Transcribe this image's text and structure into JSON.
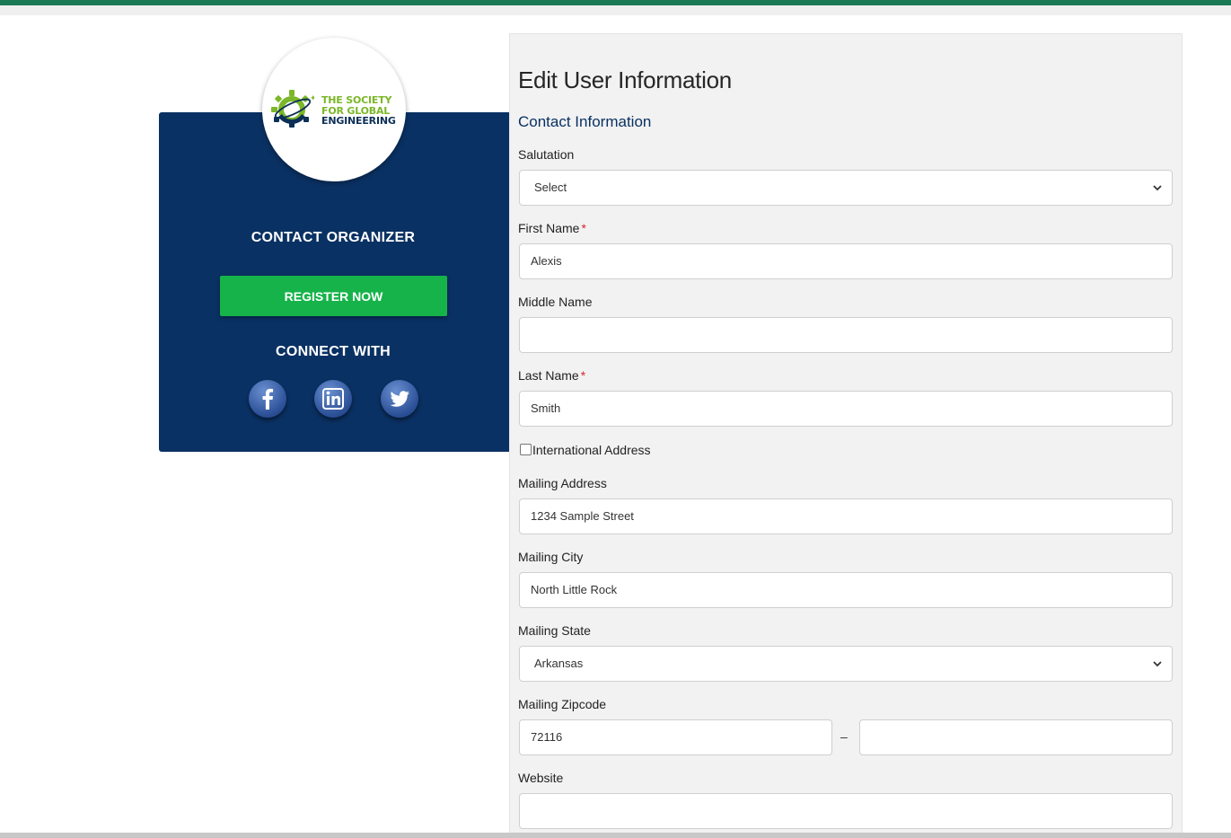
{
  "organizer": {
    "logo_lines": [
      "THE SOCIETY",
      "FOR GLOBAL",
      "ENGINEERING"
    ],
    "contact_heading": "CONTACT ORGANIZER",
    "register_label": "REGISTER NOW",
    "connect_heading": "CONNECT WITH",
    "social_icons": [
      "facebook-icon",
      "linkedin-icon",
      "twitter-icon"
    ]
  },
  "form": {
    "title": "Edit User Information",
    "section": "Contact Information",
    "salutation": {
      "label": "Salutation",
      "value": "Select"
    },
    "first_name": {
      "label": "First Name",
      "required_mark": "*",
      "value": "Alexis"
    },
    "middle_name": {
      "label": "Middle Name",
      "value": ""
    },
    "last_name": {
      "label": "Last Name",
      "required_mark": "*",
      "value": "Smith"
    },
    "international": {
      "label": "International Address",
      "checked": false
    },
    "mailing_address": {
      "label": "Mailing Address",
      "value": "1234 Sample Street"
    },
    "mailing_city": {
      "label": "Mailing City",
      "value": "North Little Rock"
    },
    "mailing_state": {
      "label": "Mailing State",
      "value": "Arkansas"
    },
    "mailing_zip": {
      "label": "Mailing Zipcode",
      "value": "72116",
      "separator": "–",
      "extension": ""
    },
    "website": {
      "label": "Website",
      "value": ""
    }
  },
  "colors": {
    "navy": "#0a3163",
    "register_green": "#16b34a",
    "top_bar_green": "#1b7a56",
    "logo_green": "#7bb728",
    "required_red": "#d9262b",
    "panel_gray": "#f2f2f2"
  }
}
